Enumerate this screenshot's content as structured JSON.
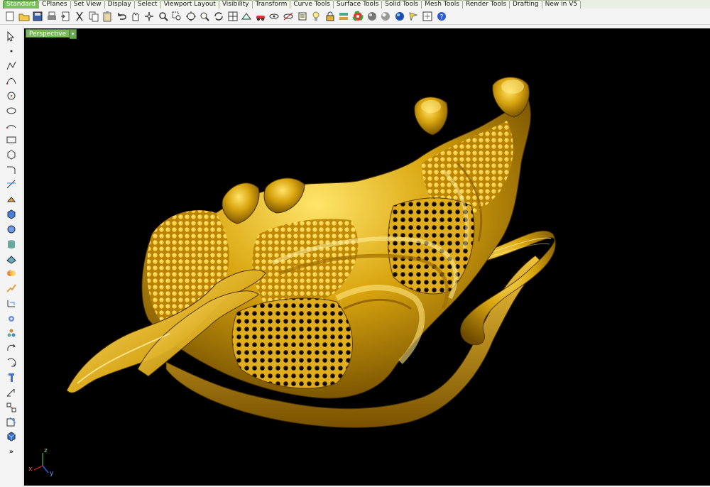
{
  "tabs": [
    "Standard",
    "CPlanes",
    "Set View",
    "Display",
    "Select",
    "Viewport Layout",
    "Visibility",
    "Transform",
    "Curve Tools",
    "Surface Tools",
    "Solid Tools",
    "Mesh Tools",
    "Render Tools",
    "Drafting",
    "New in V5"
  ],
  "active_tab": "Standard",
  "toolbar": {
    "icons": [
      "new-file-icon",
      "open-folder-icon",
      "save-icon",
      "print-icon",
      "import-icon",
      "cut-icon",
      "copy-icon",
      "paste-icon",
      "undo-icon",
      "pan-hand-icon",
      "move-view-icon",
      "zoom-icon",
      "zoom-window-icon",
      "zoom-extents-icon",
      "zoom-selected-icon",
      "rotate-view-icon",
      "four-viewports-icon",
      "cplane-icon",
      "car-icon",
      "hide-icon",
      "show-icon",
      "properties-icon",
      "light-bulb-icon",
      "lock-icon",
      "layer-icon",
      "color-wheel-icon",
      "render-sphere-icon",
      "shaded-sphere-icon",
      "render-blue-sphere-icon",
      "lights-icon",
      "options-icon",
      "help-icon"
    ]
  },
  "left_toolbar": {
    "icons": [
      "select-arrow-icon",
      "point-icon",
      "polyline-icon",
      "curve-icon",
      "circle-icon",
      "ellipse-icon",
      "arc-icon",
      "rectangle-icon",
      "polygon-icon",
      "fillet-icon",
      "trim-icon",
      "extrude-icon",
      "box-icon",
      "sphere-icon",
      "cylinder-icon",
      "surface-icon",
      "boolean-icon",
      "explode-icon",
      "join-icon",
      "group-icon",
      "analyze-icon",
      "array-icon",
      "rotate-icon",
      "text-icon",
      "dimension-icon",
      "align-icon",
      "bend-icon",
      "render-cube-icon"
    ],
    "more_label": "»"
  },
  "viewport": {
    "title": "Perspective",
    "axes": {
      "z": "z",
      "x": "x",
      "y": "y"
    }
  },
  "colors": {
    "gold_base": "#d19a08",
    "gold_highlight": "#ffe56a",
    "gold_shadow": "#6e4a00",
    "viewport_bg": "#000000",
    "active_tab": "#79c05f"
  }
}
